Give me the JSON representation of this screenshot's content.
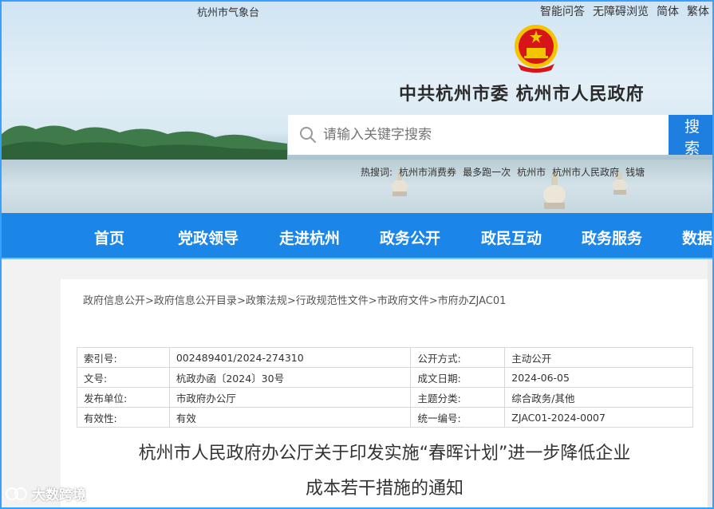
{
  "topbar": {
    "weather": "杭州市气象台",
    "links": [
      "智能问答",
      "无障碍浏览",
      "简体",
      "繁体"
    ]
  },
  "header": {
    "site_title": "中共杭州市委  杭州市人民政府",
    "emblem_icon": "national-emblem-icon"
  },
  "search": {
    "placeholder": "请输入关键字搜索",
    "button_label": "搜索",
    "hotwords_label": "热搜词:",
    "hotwords": [
      "杭州市消费券",
      "最多跑一次",
      "杭州市",
      "杭州市人民政府",
      "钱塘"
    ]
  },
  "nav": {
    "items": [
      "首页",
      "党政领导",
      "走进杭州",
      "政务公开",
      "政民互动",
      "政务服务",
      "数据"
    ]
  },
  "breadcrumb": {
    "items": [
      "政府信息公开",
      "政府信息公开目录",
      "政策法规",
      "行政规范性文件",
      "市政府文件",
      "市府办ZJAC01"
    ],
    "separator": ">"
  },
  "meta": {
    "rows": [
      {
        "l1": "索引号:",
        "v1": "002489401/2024-274310",
        "l2": "公开方式:",
        "v2": "主动公开"
      },
      {
        "l1": "文号:",
        "v1": "杭政办函〔2024〕30号",
        "l2": "成文日期:",
        "v2": "2024-06-05"
      },
      {
        "l1": "发布单位:",
        "v1": "市政府办公厅",
        "l2": "主题分类:",
        "v2": "综合政务/其他"
      },
      {
        "l1": "有效性:",
        "v1": "有效",
        "l2": "统一编号:",
        "v2": "ZJAC01-2024-0007"
      }
    ]
  },
  "document": {
    "title_line1": "杭州市人民政府办公厅关于印发实施“春晖计划”进一步降低企业",
    "title_line2": "成本若干措施的通知"
  },
  "watermark": {
    "text": "大数跨境"
  },
  "colors": {
    "nav_blue": "#1b86e8",
    "search_button": "#1f7fe0",
    "emblem_red": "#d7141a",
    "emblem_gold": "#f5c400"
  }
}
